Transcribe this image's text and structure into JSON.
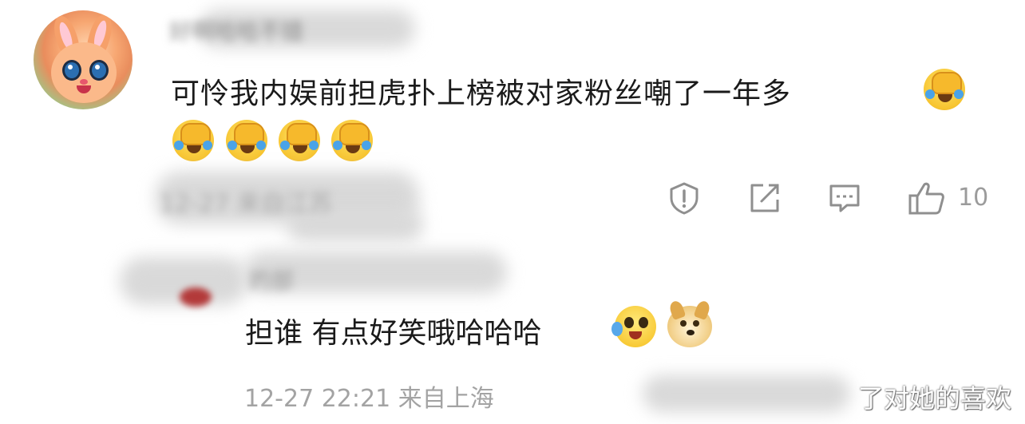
{
  "comment_main": {
    "username": "好啊哈哈不错",
    "text": "可怜我内娱前担虎扑上榜被对家粉丝嘲了一年多",
    "meta": "12-27 来自江苏",
    "like_count": "10",
    "emoji_trailing_icon": "facepalm-cry-emoji",
    "emoji_row": [
      "facepalm-cry-emoji",
      "facepalm-cry-emoji",
      "facepalm-cry-emoji",
      "facepalm-cry-emoji"
    ]
  },
  "actions": {
    "report_icon": "report-shield-icon",
    "share_icon": "share-edit-icon",
    "comment_icon": "comment-bubble-icon",
    "like_icon": "thumbs-up-icon"
  },
  "reply": {
    "username": "的部",
    "text": "担谁 有点好笑哦哈哈哈",
    "meta": "12-27 22:21 来自上海",
    "emojis": [
      "sweat-laugh-emoji",
      "doge-emoji"
    ]
  },
  "watermark": {
    "text": "了对她的喜欢"
  }
}
